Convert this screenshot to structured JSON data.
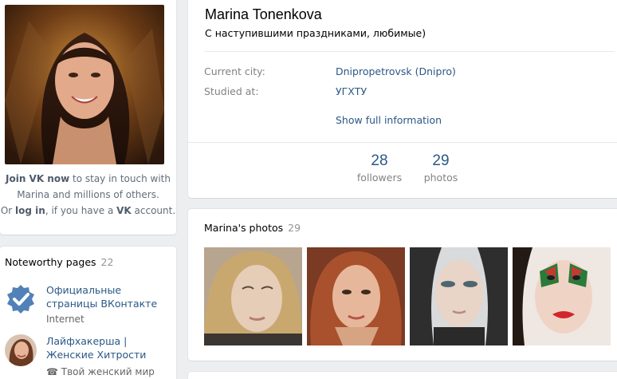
{
  "profile": {
    "name": "Marina Tonenkova",
    "status": "С наступившими праздниками, любимые)",
    "city_label": "Current city:",
    "city_value": "Dnipropetrovsk (Dnipro)",
    "studied_label": "Studied at:",
    "studied_value": "УГХТУ",
    "show_full": "Show full information"
  },
  "counters": [
    {
      "value": "28",
      "label": "followers"
    },
    {
      "value": "29",
      "label": "photos"
    }
  ],
  "join": {
    "strong1": "Join VK now",
    "text1": " to stay in touch with",
    "text2": "Marina and millions of others.",
    "text3a": "Or ",
    "strong2": "log in",
    "text3b": ", if you have a ",
    "strong3": "VK",
    "text3c": " account."
  },
  "noteworthy": {
    "title": "Noteworthy pages",
    "count": "22",
    "items": [
      {
        "title": "Официальные страницы ВКонтакте",
        "subtitle": "Internet"
      },
      {
        "title": "Лайфхакерша | Женские Хитрости",
        "subtitle": "☎ Твой женский мир"
      }
    ]
  },
  "photos": {
    "title": "Marina's photos",
    "count": "29"
  },
  "colors": {
    "link": "#2a5885",
    "muted": "#828282",
    "verified": "#5181b8"
  }
}
